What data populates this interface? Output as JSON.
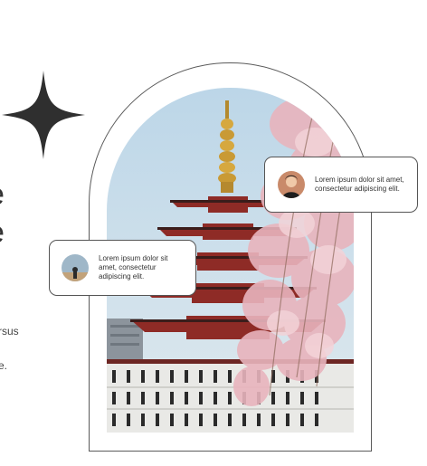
{
  "left_column": {
    "heading_line1": "e",
    "heading_line2": "e",
    "body_line1": "rsus",
    "body_line2": "e."
  },
  "cards": [
    {
      "text": "Lorem ipsum dolor sit amet, consectetur adipiscing elit.",
      "avatar": "person-avatar"
    },
    {
      "text": "Lorem ipsum dolor sit amet, consectetur adipiscing elit.",
      "avatar": "landscape-avatar"
    }
  ],
  "photo": {
    "subject": "pagoda-with-cherry-blossoms"
  },
  "icons": {
    "sparkle": "sparkle-icon"
  },
  "colors": {
    "sparkle": "#2f2f2f",
    "outline": "#5a5a5a",
    "pagoda": "#8e2b26",
    "blossom": "#e8b4bd",
    "sky": "#c9dce8"
  }
}
